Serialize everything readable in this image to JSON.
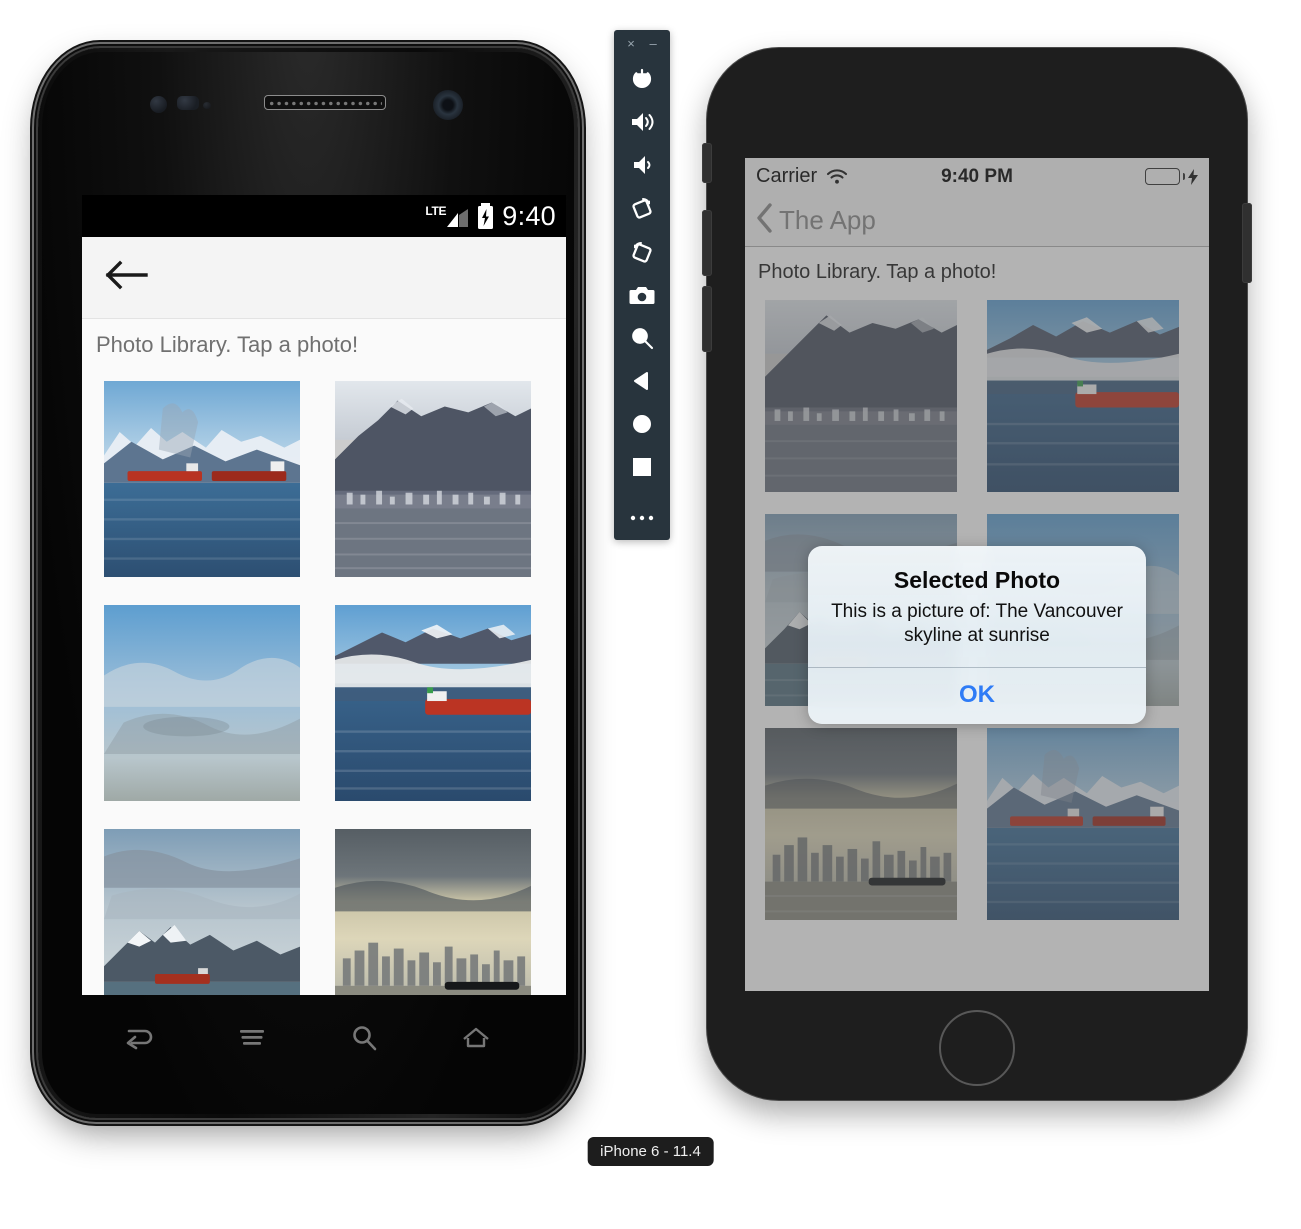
{
  "android": {
    "status_bar": {
      "network_label": "LTE",
      "time": "9:40",
      "battery_icon": "battery-charging-icon",
      "signal_icon": "signal-bars-icon"
    },
    "appbar": {
      "back_icon": "arrow-left-icon"
    },
    "subtitle": "Photo Library. Tap a photo!",
    "photos": [
      {
        "name": "two-red-tankers-snowy-mountains",
        "alt": "Two red tankers in front of snowy mountains"
      },
      {
        "name": "mountain-over-city-skyline",
        "alt": "Dark mountain above a hazy city skyline"
      },
      {
        "name": "blue-sky-over-clouds",
        "alt": "Blue sky over a low cloud bank"
      },
      {
        "name": "red-tanker-cloud-bank",
        "alt": "Red tanker in front of a low cloud bank"
      },
      {
        "name": "red-tanker-sunlit-peaks",
        "alt": "Red tanker below sunlit snowy peaks"
      },
      {
        "name": "vancouver-skyline-sunrise",
        "alt": "The Vancouver skyline at sunrise"
      }
    ],
    "nav_buttons": [
      {
        "name": "back-icon",
        "label": "Back"
      },
      {
        "name": "menu-icon",
        "label": "Menu"
      },
      {
        "name": "search-icon",
        "label": "Search"
      },
      {
        "name": "home-icon",
        "label": "Home"
      }
    ]
  },
  "emulator_toolbar": {
    "close_label": "×",
    "minimize_label": "–",
    "buttons": [
      {
        "name": "power-icon",
        "label": "Power"
      },
      {
        "name": "volume-up-icon",
        "label": "Volume Up"
      },
      {
        "name": "volume-down-icon",
        "label": "Volume Down"
      },
      {
        "name": "rotate-left-icon",
        "label": "Rotate Left"
      },
      {
        "name": "rotate-right-icon",
        "label": "Rotate Right"
      },
      {
        "name": "camera-icon",
        "label": "Take Screenshot"
      },
      {
        "name": "zoom-icon",
        "label": "Zoom"
      },
      {
        "name": "back-triangle-icon",
        "label": "Back"
      },
      {
        "name": "home-circle-icon",
        "label": "Home"
      },
      {
        "name": "overview-square-icon",
        "label": "Overview"
      },
      {
        "name": "more-icon",
        "label": "More"
      }
    ]
  },
  "ios": {
    "status_bar": {
      "carrier": "Carrier",
      "wifi_icon": "wifi-icon",
      "time": "9:40 PM",
      "battery_icon": "battery-charging-icon"
    },
    "navbar": {
      "back_icon": "chevron-left-icon",
      "back_label": "The App"
    },
    "subtitle": "Photo Library. Tap a photo!",
    "photos": [
      {
        "name": "mountain-over-city-skyline",
        "alt": "Dark mountain above a hazy city skyline"
      },
      {
        "name": "red-tanker-cloud-bank",
        "alt": "Red tanker in front of a low cloud bank"
      },
      {
        "name": "red-tanker-sunlit-peaks",
        "alt": "Red tanker below sunlit snowy peaks"
      },
      {
        "name": "blue-sky-over-clouds",
        "alt": "Blue sky over a low cloud bank"
      },
      {
        "name": "vancouver-skyline-sunrise",
        "alt": "The Vancouver skyline at sunrise"
      },
      {
        "name": "two-red-tankers-snowy-mountains",
        "alt": "Two red tankers in front of snowy mountains"
      }
    ],
    "alert": {
      "title": "Selected Photo",
      "message": "This is a picture of: The Vancouver skyline at sunrise",
      "ok_label": "OK",
      "accent_color": "#2e7bf6"
    },
    "device_label": "iPhone 6 - 11.4"
  },
  "colors": {
    "ios_accent": "#2e7bf6",
    "ios_battery_green": "#4cd964",
    "emulator_toolbar_bg": "#28343d",
    "android_appbar_bg": "#f4f4f4",
    "android_screen_bg": "#fafafa"
  }
}
